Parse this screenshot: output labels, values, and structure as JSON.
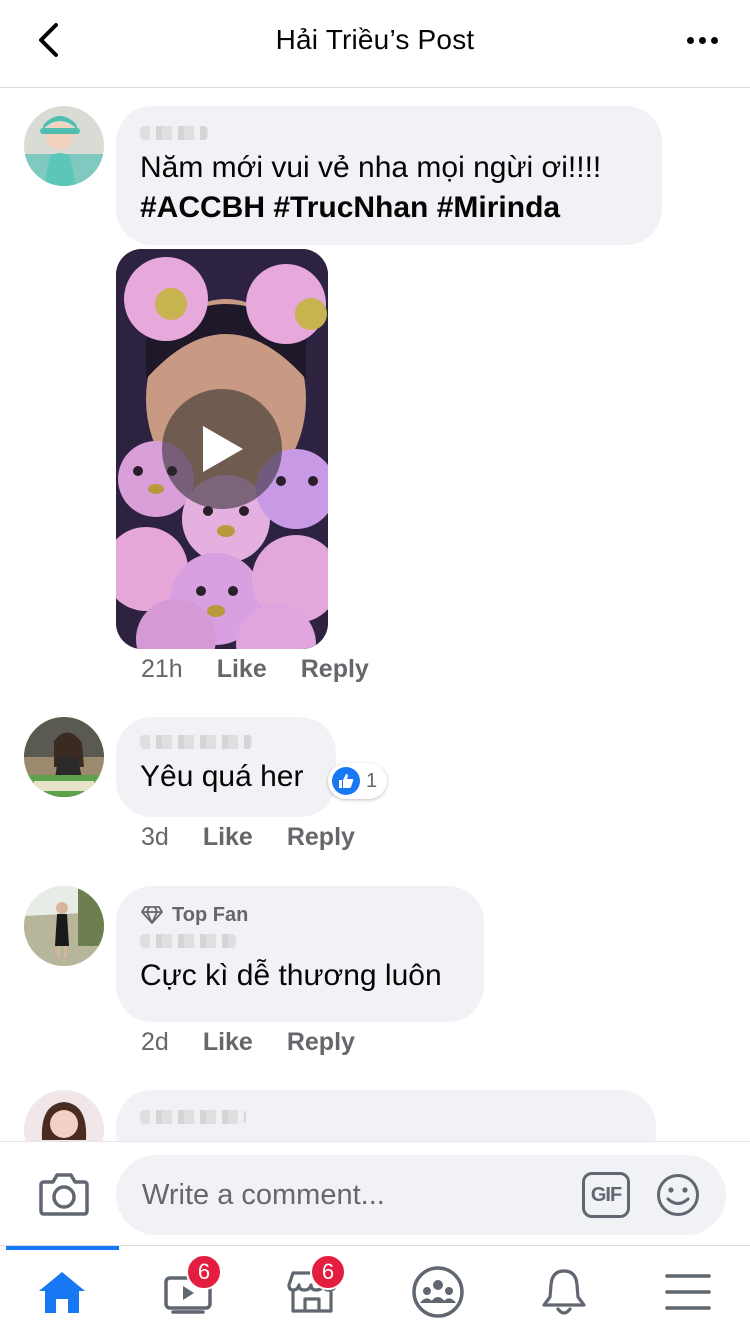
{
  "header": {
    "title": "Hải Triều’s Post"
  },
  "comments": [
    {
      "text_line1": "Năm mới vui vẻ  nha mọi ngừi ơi!!!!",
      "text_line2": "#ACCBH #TrucNhan #Mirinda",
      "time": "21h",
      "like": "Like",
      "reply": "Reply"
    },
    {
      "text": "Yêu quá her",
      "reaction_count": "1",
      "time": "3d",
      "like": "Like",
      "reply": "Reply"
    },
    {
      "badge": "Top Fan",
      "text": "Cực kì dễ thương luôn",
      "time": "2d",
      "like": "Like",
      "reply": "Reply"
    }
  ],
  "composer": {
    "placeholder": "Write a comment...",
    "gif_label": "GIF"
  },
  "nav": {
    "watch_badge": "6",
    "marketplace_badge": "6"
  },
  "colors": {
    "accent": "#1877f2",
    "badge": "#e41e3f",
    "bubble": "#f0f2f5",
    "secondary_text": "#65676b"
  },
  "icons": [
    "back-icon",
    "more-icon",
    "play-icon",
    "like-reaction-icon",
    "diamond-icon",
    "camera-icon",
    "gif-icon",
    "smiley-icon",
    "home-icon",
    "watch-icon",
    "marketplace-icon",
    "groups-icon",
    "bell-icon",
    "menu-icon"
  ]
}
